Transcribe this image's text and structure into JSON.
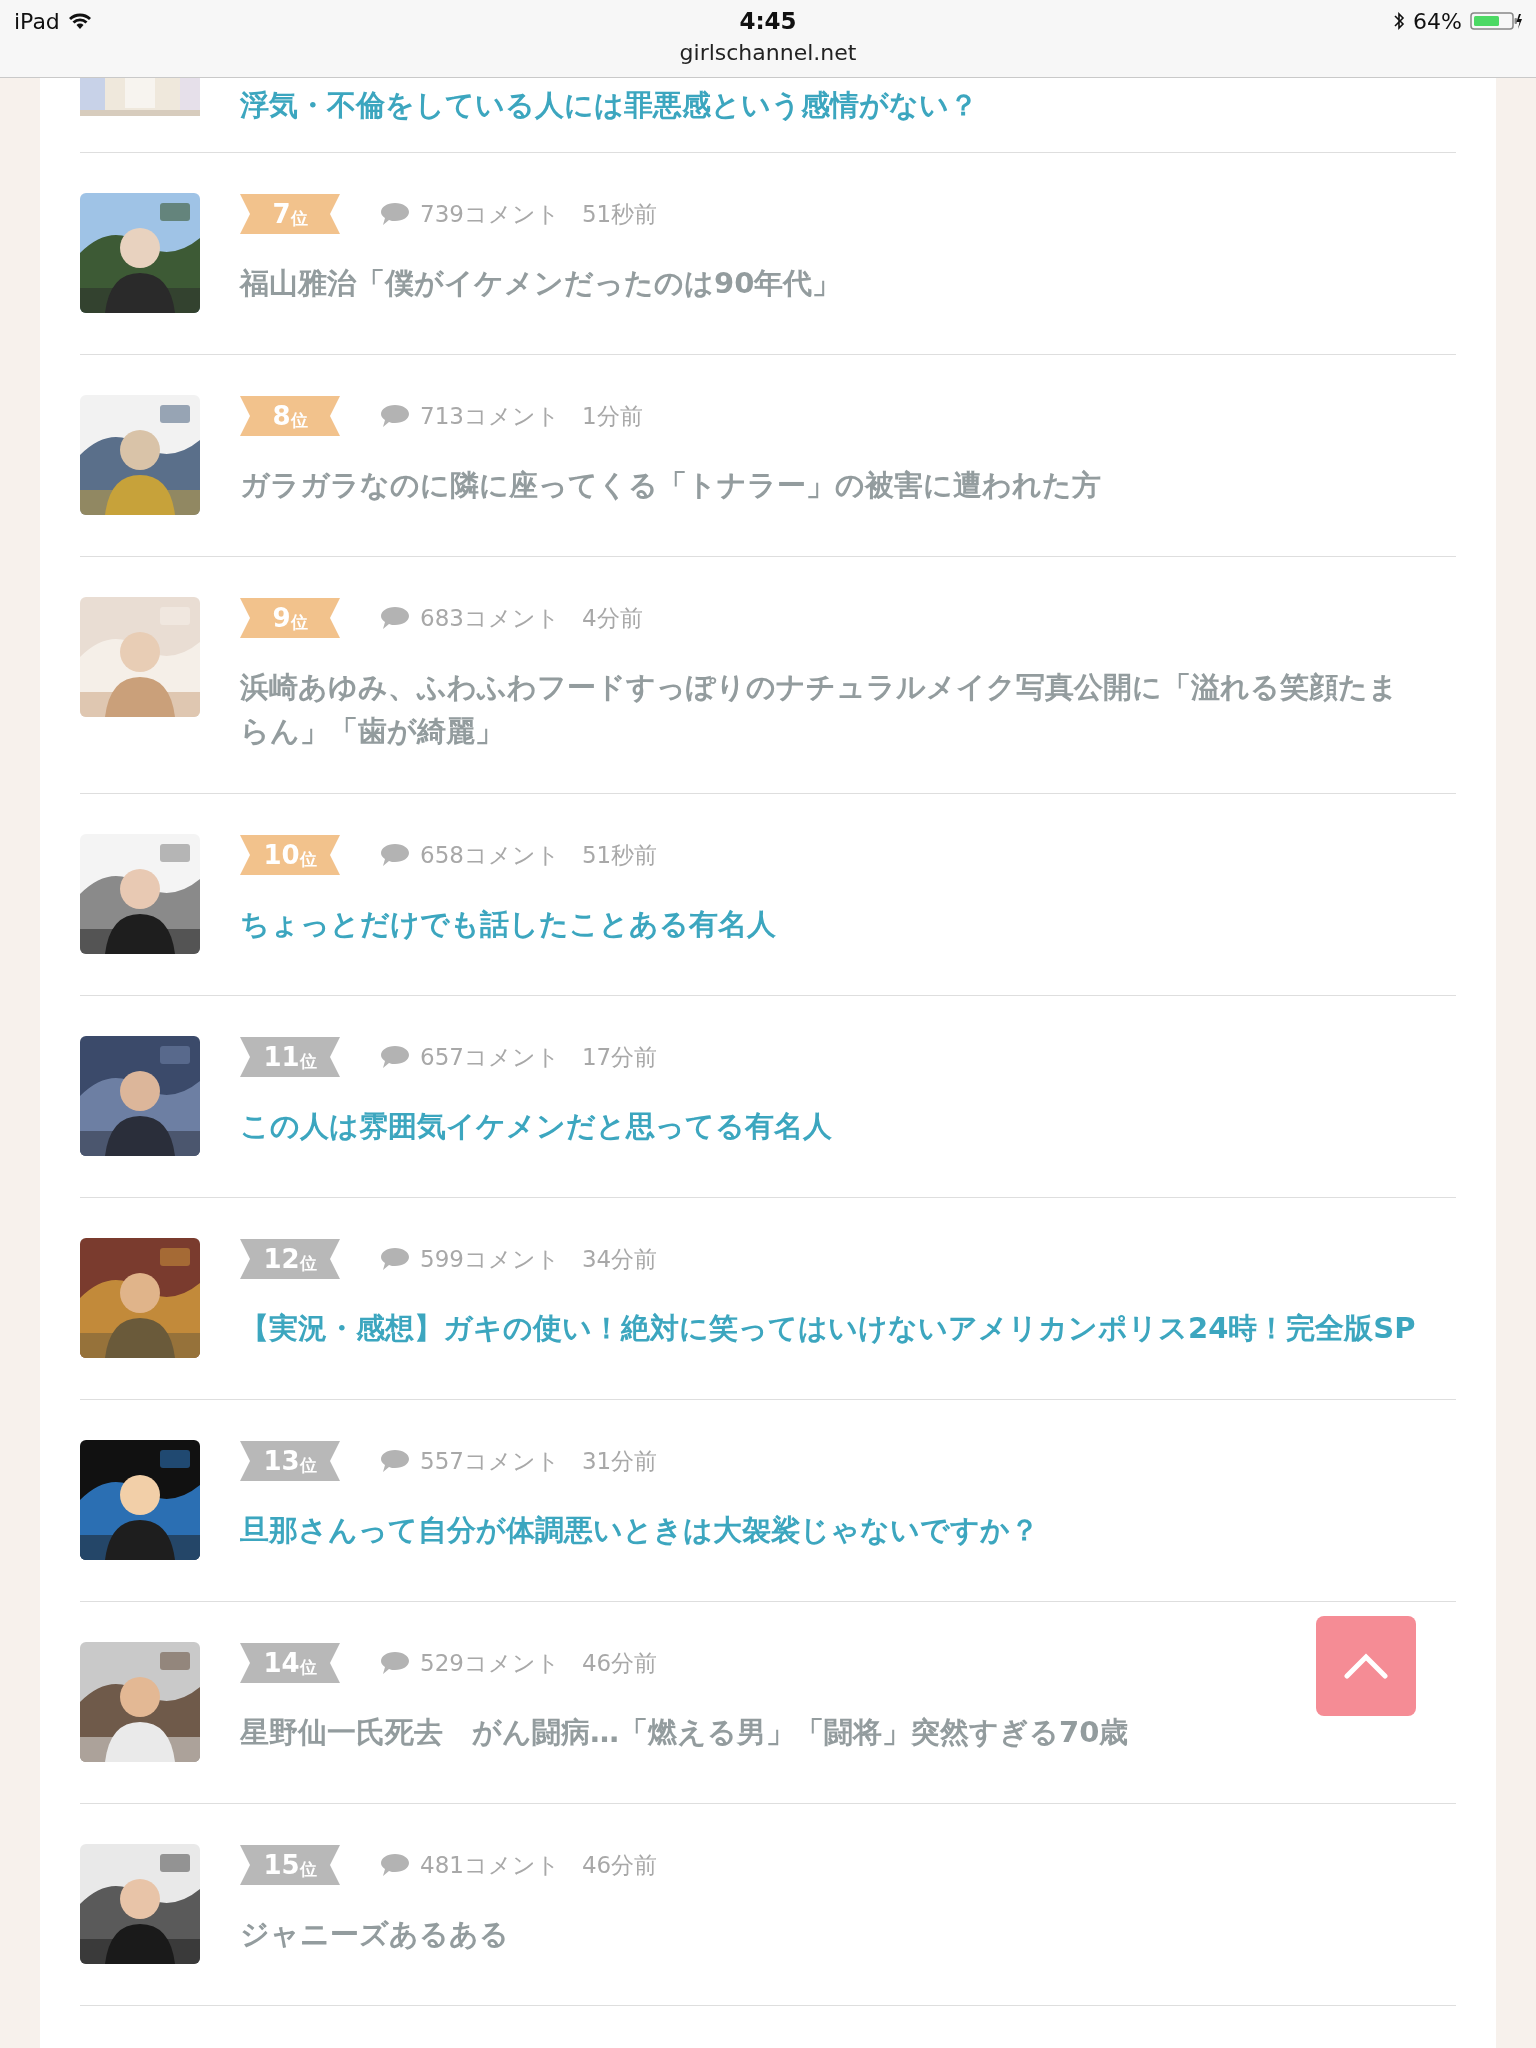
{
  "status_bar": {
    "carrier": "iPad",
    "time": "4:45",
    "url": "girlschannel.net",
    "battery": "64%"
  },
  "cut_topic": {
    "title": "浮気・不倫をしている人には罪悪感という感情がない？",
    "visited": false
  },
  "topics": [
    {
      "rank": "7",
      "rank_unit": "位",
      "color": "#f2c28c",
      "comments": "739コメント",
      "time": "51秒前",
      "title": "福山雅治「僕がイケメンだったのは90年代」",
      "visited": true
    },
    {
      "rank": "8",
      "rank_unit": "位",
      "color": "#f2c28c",
      "comments": "713コメント",
      "time": "1分前",
      "title": "ガラガラなのに隣に座ってくる「トナラー」の被害に遭われた方",
      "visited": true
    },
    {
      "rank": "9",
      "rank_unit": "位",
      "color": "#f2c28c",
      "comments": "683コメント",
      "time": "4分前",
      "title": "浜崎あゆみ、ふわふわフードすっぽりのナチュラルメイク写真公開に「溢れる笑顔たまらん」「歯が綺麗」",
      "visited": true
    },
    {
      "rank": "10",
      "rank_unit": "位",
      "color": "#f2c28c",
      "comments": "658コメント",
      "time": "51秒前",
      "title": "ちょっとだけでも話したことある有名人",
      "visited": false
    },
    {
      "rank": "11",
      "rank_unit": "位",
      "color": "#b8b8b8",
      "comments": "657コメント",
      "time": "17分前",
      "title": "この人は雰囲気イケメンだと思ってる有名人",
      "visited": false
    },
    {
      "rank": "12",
      "rank_unit": "位",
      "color": "#b8b8b8",
      "comments": "599コメント",
      "time": "34分前",
      "title": "【実況・感想】ガキの使い！絶対に笑ってはいけないアメリカンポリス24時！完全版SP",
      "visited": false
    },
    {
      "rank": "13",
      "rank_unit": "位",
      "color": "#b8b8b8",
      "comments": "557コメント",
      "time": "31分前",
      "title": "旦那さんって自分が体調悪いときは大袈裟じゃないですか？",
      "visited": false
    },
    {
      "rank": "14",
      "rank_unit": "位",
      "color": "#b8b8b8",
      "comments": "529コメント",
      "time": "46分前",
      "title": "星野仙一氏死去　がん闘病…「燃える男」「闘将」突然すぎる70歳",
      "visited": true
    },
    {
      "rank": "15",
      "rank_unit": "位",
      "color": "#b8b8b8",
      "comments": "481コメント",
      "time": "46分前",
      "title": "ジャニーズあるある",
      "visited": true
    }
  ]
}
